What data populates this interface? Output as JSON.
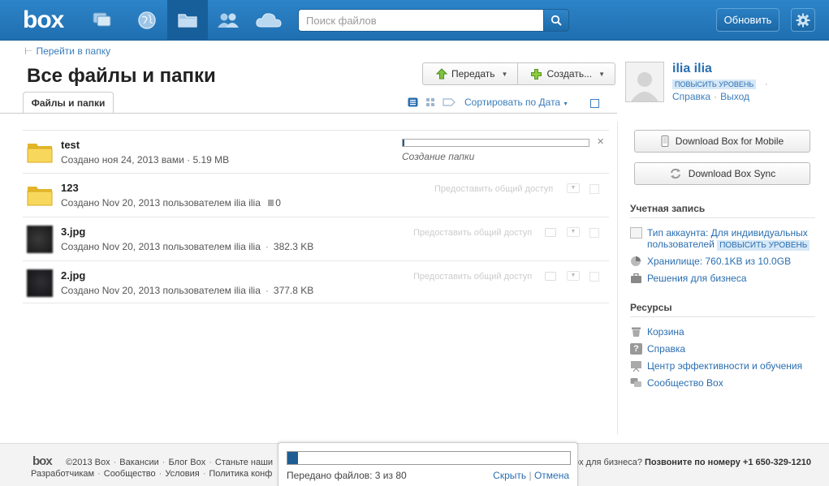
{
  "topbar": {
    "logo": "box",
    "search_placeholder": "Поиск файлов",
    "upgrade_label": "Обновить",
    "nav": [
      "chat-icon",
      "globe-icon",
      "folder-icon",
      "users-icon",
      "cloud-icon"
    ]
  },
  "header": {
    "goto_folder": "Перейти в папку",
    "title": "Все файлы и папки",
    "tab": "Файлы и папки",
    "upload_label": "Передать",
    "create_label": "Создать...",
    "sort_label": "Сортировать по Дата"
  },
  "user": {
    "name": "ilia ilia",
    "upgrade_badge": "ПОВЫСИТЬ УРОВЕНЬ",
    "help": "Справка",
    "logout": "Выход"
  },
  "files": [
    {
      "name": "test",
      "meta": "Создано ноя 24, 2013 вами · 5.19 MB",
      "type": "folder",
      "status": "Создание папки",
      "progress": 0.01
    },
    {
      "name": "123",
      "meta": "Создано Nov 20, 2013 пользователем ilia ilia",
      "count": "0",
      "type": "folder",
      "share": "Предоставить общий доступ"
    },
    {
      "name": "3.jpg",
      "meta": "Создано Nov 20, 2013 пользователем ilia ilia",
      "size": "382.3 KB",
      "type": "image",
      "share": "Предоставить общий доступ"
    },
    {
      "name": "2.jpg",
      "meta": "Создано Nov 20, 2013 пользователем ilia ilia",
      "size": "377.8 KB",
      "type": "image",
      "share": "Предоставить общий доступ"
    }
  ],
  "sidebar": {
    "mobile_btn": "Download Box for Mobile",
    "sync_btn": "Download Box Sync",
    "account_head": "Учетная запись",
    "account_type": "Тип аккаунта: Для индивидуальных пользователей",
    "account_badge": "ПОВЫСИТЬ УРОВЕНЬ",
    "storage": "Хранилище: 760.1KB из 10.0GB",
    "business": "Решения для бизнеса",
    "resources_head": "Ресурсы",
    "trash": "Корзина",
    "help": "Справка",
    "training": "Центр эффективности и обучения",
    "community": "Сообщество Box"
  },
  "footer": {
    "logo": "box",
    "copyright": "©2013 Box",
    "jobs": "Вакансии",
    "blog": "Блог Box",
    "partner": "Станьте наши",
    "developers": "Разработчикам",
    "community": "Сообщество",
    "terms": "Условия",
    "policy": "Политика конф",
    "business_q": "ox для бизнеса?",
    "phone": "Позвоните по номеру +1 650-329-1210"
  },
  "upload": {
    "text": "Передано файлов: 3 из 80",
    "hide": "Скрыть",
    "cancel": "Отмена",
    "progress": 0.0375
  }
}
